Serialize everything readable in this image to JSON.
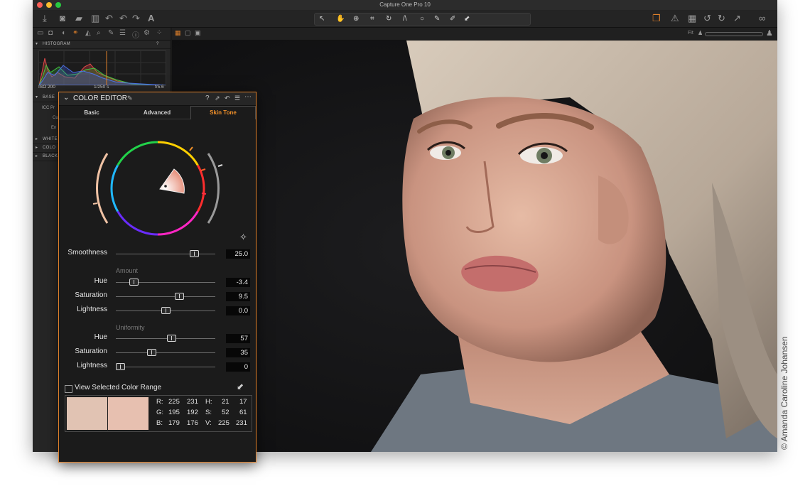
{
  "app": {
    "title": "Capture One Pro 10"
  },
  "toolbar": {
    "fit_label": "Fit"
  },
  "histogram": {
    "section_label": "HISTOGRAM",
    "help": "?",
    "iso": "ISO 200",
    "shutter": "1/250 s",
    "aperture": "f/5.6"
  },
  "left_panel": {
    "base_label": "BASE",
    "icc_label": "ICC Pr",
    "row2_label": "Cu",
    "row3_label": "En",
    "white_label": "WHITE",
    "color_label": "COLO",
    "black_label": "BLACK"
  },
  "color_editor": {
    "title": "COLOR EDITOR",
    "help": "?",
    "tabs": [
      "Basic",
      "Advanced",
      "Skin Tone"
    ],
    "active_tab": 2,
    "smoothness": {
      "label": "Smoothness",
      "value": "25.0",
      "position": 0.82
    },
    "amount": {
      "label": "Amount",
      "rows": [
        {
          "label": "Hue",
          "value": "-3.4",
          "position": 0.15
        },
        {
          "label": "Saturation",
          "value": "9.5",
          "position": 0.65
        },
        {
          "label": "Lightness",
          "value": "0.0",
          "position": 0.5
        }
      ]
    },
    "uniformity": {
      "label": "Uniformity",
      "rows": [
        {
          "label": "Hue",
          "value": "57",
          "position": 0.57
        },
        {
          "label": "Saturation",
          "value": "35",
          "position": 0.35
        },
        {
          "label": "Lightness",
          "value": "0",
          "position": 0.0
        }
      ]
    },
    "view_range_label": "View Selected Color Range",
    "swatches": [
      "#e1c3b3",
      "#e7c0b0"
    ],
    "readout": {
      "r": [
        "R:",
        "225",
        "231"
      ],
      "g": [
        "G:",
        "195",
        "192"
      ],
      "b": [
        "B:",
        "179",
        "176"
      ],
      "h": [
        "H:",
        "21",
        "17"
      ],
      "s": [
        "S:",
        "52",
        "61"
      ],
      "v": [
        "V:",
        "225",
        "231"
      ]
    }
  },
  "credit": "© Amanda Caroline Johansen",
  "colors": {
    "accent": "#e0802a",
    "panel": "#1b1b1b",
    "app_bg": "#1a1a1a"
  }
}
